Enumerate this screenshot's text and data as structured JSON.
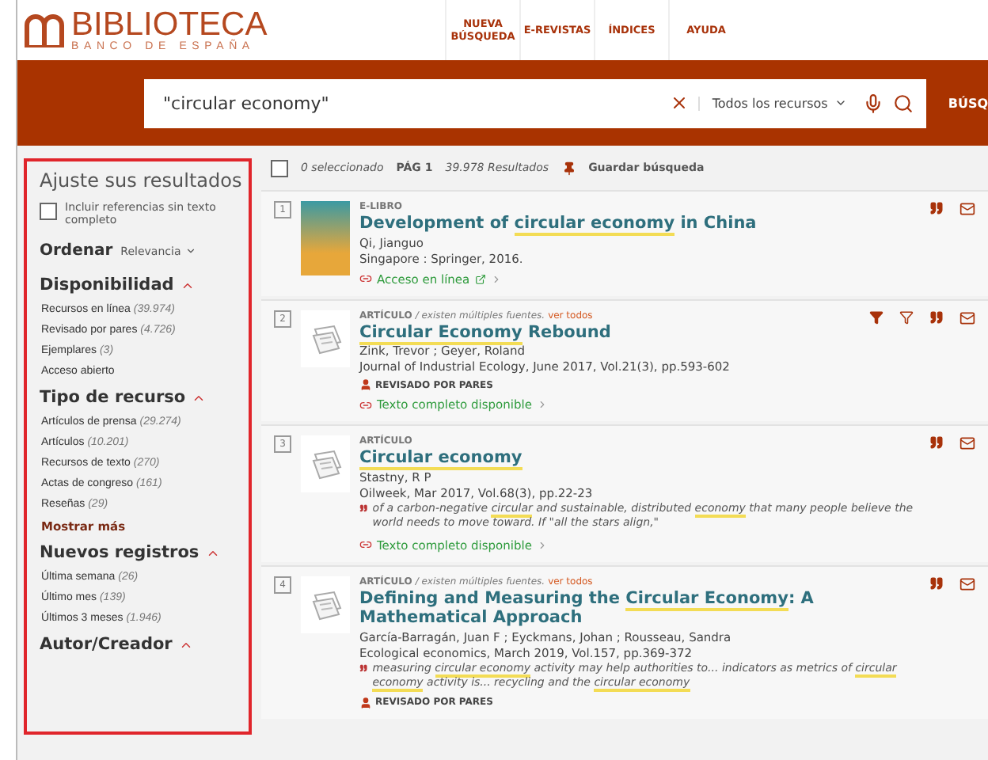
{
  "header": {
    "logo_title": "BIBLIOTECA",
    "logo_subtitle": "BANCO DE ESPAÑA",
    "nav": [
      "NUEVA BÚSQUEDA",
      "E-REVISTAS",
      "ÍNDICES",
      "AYUDA"
    ]
  },
  "search": {
    "value": "\"circular economy\"",
    "scope": "Todos los recursos",
    "submit": "BÚSQ"
  },
  "sidebar": {
    "title": "Ajuste sus resultados",
    "include_option": {
      "label": "Incluir referencias sin texto completo",
      "checked": false
    },
    "sort": {
      "label": "Ordenar",
      "value": "Relevancia"
    },
    "facets": [
      {
        "title": "Disponibilidad",
        "expanded": true,
        "items": [
          {
            "label": "Recursos en línea",
            "count": "(39.974)"
          },
          {
            "label": "Revisado por pares",
            "count": "(4.726)"
          },
          {
            "label": "Ejemplares",
            "count": "(3)"
          },
          {
            "label": "Acceso abierto"
          }
        ]
      },
      {
        "title": "Tipo de recurso",
        "expanded": true,
        "items": [
          {
            "label": "Artículos de prensa",
            "count": "(29.274)"
          },
          {
            "label": "Artículos",
            "count": "(10.201)"
          },
          {
            "label": "Recursos de texto",
            "count": "(270)"
          },
          {
            "label": "Actas de congreso",
            "count": "(161)"
          },
          {
            "label": "Reseñas",
            "count": "(29)"
          }
        ],
        "more": "Mostrar más"
      },
      {
        "title": "Nuevos registros",
        "expanded": true,
        "items": [
          {
            "label": "Última semana",
            "count": "(26)"
          },
          {
            "label": "Último mes",
            "count": "(139)"
          },
          {
            "label": "Últimos 3 meses",
            "count": "(1.946)"
          }
        ]
      },
      {
        "title": "Autor/Creador",
        "expanded": true
      }
    ]
  },
  "toolbar": {
    "select_all": false,
    "selected": "0 seleccionado",
    "page": "PÁG 1",
    "results": "39.978 Resultados",
    "save": "Guardar búsqueda"
  },
  "results": [
    {
      "number": "1",
      "thumbnail": {
        "kind": "cover"
      },
      "type": "E-LIBRO",
      "title": [
        {
          "text": "Development of ",
          "highlight": false
        },
        {
          "text": "circular economy",
          "highlight": true
        },
        {
          "text": " in China",
          "highlight": false
        }
      ],
      "authors": "Qi, Jianguo",
      "source": "Singapore : Springer, 2016.",
      "peer_reviewed": false,
      "access": "Acceso en línea",
      "access_external": true,
      "actions": [
        {
          "kind": "quote"
        },
        {
          "kind": "email"
        }
      ]
    },
    {
      "number": "2",
      "thumbnail": {
        "kind": "article"
      },
      "type": "ARTÍCULO",
      "sources_note": "/ existen múltiples fuentes.",
      "see_all": "ver todos",
      "title": [
        {
          "text": "Circular Economy",
          "highlight": true
        },
        {
          "text": " Rebound",
          "highlight": false
        }
      ],
      "authors": "Zink, Trevor ; Geyer, Roland",
      "source": "Journal of Industrial Ecology, June 2017, Vol.21(3), pp.593-602",
      "peer_reviewed": true,
      "peer_label": "REVISADO POR PARES",
      "access": "Texto completo disponible",
      "access_external": false,
      "actions": [
        {
          "kind": "filter"
        },
        {
          "kind": "filter-outline"
        },
        {
          "kind": "quote"
        },
        {
          "kind": "email"
        }
      ]
    },
    {
      "number": "3",
      "thumbnail": {
        "kind": "article"
      },
      "type": "ARTÍCULO",
      "title": [
        {
          "text": "Circular economy",
          "highlight": true
        }
      ],
      "authors": "Stastny, R P",
      "source": "Oilweek, Mar 2017, Vol.68(3), pp.22-23",
      "snippet": [
        {
          "text": "of a carbon-negative ",
          "highlight": false
        },
        {
          "text": "circular",
          "highlight": true
        },
        {
          "text": " and sustainable, distributed ",
          "highlight": false
        },
        {
          "text": "economy",
          "highlight": true
        },
        {
          "text": " that many people believe the world needs to move toward. If \"all the stars align,\"",
          "highlight": false
        }
      ],
      "peer_reviewed": false,
      "access": "Texto completo disponible",
      "access_external": false,
      "actions": [
        {
          "kind": "quote"
        },
        {
          "kind": "email"
        }
      ]
    },
    {
      "number": "4",
      "thumbnail": {
        "kind": "article"
      },
      "type": "ARTÍCULO",
      "sources_note": "/ existen múltiples fuentes.",
      "see_all": "ver todos",
      "title": [
        {
          "text": "Defining and Measuring the ",
          "highlight": false
        },
        {
          "text": "Circular Economy",
          "highlight": true
        },
        {
          "text": ": A Mathematical Approach",
          "highlight": false
        }
      ],
      "authors": "García-Barragán, Juan F ; Eyckmans, Johan ; Rousseau, Sandra",
      "source": "Ecological economics, March 2019, Vol.157, pp.369-372",
      "snippet": [
        {
          "text": "measuring ",
          "highlight": false
        },
        {
          "text": "circular economy",
          "highlight": true
        },
        {
          "text": " activity may help authorities to... indicators as metrics of ",
          "highlight": false
        },
        {
          "text": "circular economy",
          "highlight": true
        },
        {
          "text": " activity is... recycling and the ",
          "highlight": false
        },
        {
          "text": "circular economy",
          "highlight": true
        }
      ],
      "peer_reviewed": true,
      "peer_label": "REVISADO POR PARES",
      "actions": [
        {
          "kind": "quote"
        },
        {
          "kind": "email"
        }
      ]
    }
  ]
}
